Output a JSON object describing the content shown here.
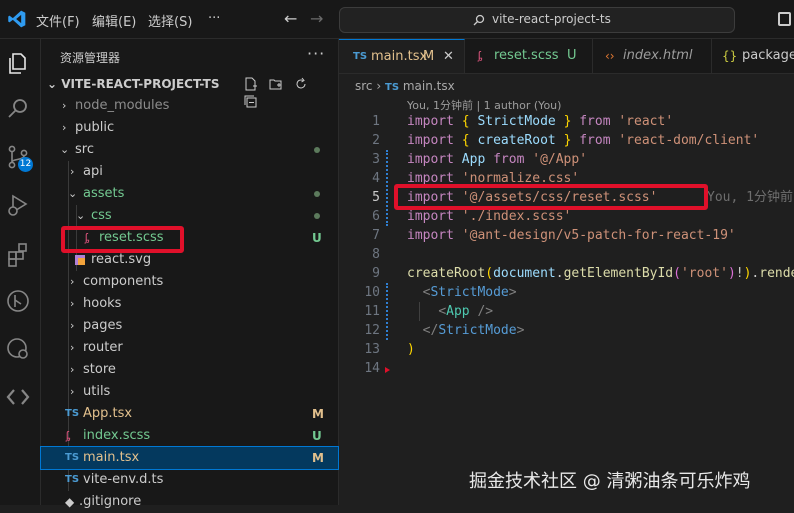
{
  "menubar": {
    "items": [
      "文件(F)",
      "编辑(E)",
      "选择(S)"
    ],
    "more": "···"
  },
  "search": {
    "text": "vite-react-project-ts"
  },
  "activity": {
    "scm_badge": "12"
  },
  "explorer": {
    "title": "资源管理器",
    "more": "···",
    "project": "VITE-REACT-PROJECT-TS",
    "rows": [
      {
        "label": "node_modules",
        "status": ""
      },
      {
        "label": "public",
        "status": ""
      },
      {
        "label": "src",
        "status": ""
      },
      {
        "label": "api",
        "status": ""
      },
      {
        "label": "assets",
        "status": ""
      },
      {
        "label": "css",
        "status": ""
      },
      {
        "label": "reset.scss",
        "status": "U"
      },
      {
        "label": "react.svg",
        "status": ""
      },
      {
        "label": "components",
        "status": ""
      },
      {
        "label": "hooks",
        "status": ""
      },
      {
        "label": "pages",
        "status": ""
      },
      {
        "label": "router",
        "status": ""
      },
      {
        "label": "store",
        "status": ""
      },
      {
        "label": "utils",
        "status": ""
      },
      {
        "label": "App.tsx",
        "status": "M"
      },
      {
        "label": "index.scss",
        "status": "U"
      },
      {
        "label": "main.tsx",
        "status": "M"
      },
      {
        "label": "vite-env.d.ts",
        "status": ""
      },
      {
        "label": ".gitignore",
        "status": ""
      }
    ],
    "ts_badge": "TS"
  },
  "tabs": [
    {
      "label": "main.tsx",
      "badge": "M"
    },
    {
      "label": "reset.scss",
      "badge": "U"
    },
    {
      "label": "index.html",
      "badge": ""
    },
    {
      "label": "package.",
      "badge": ""
    }
  ],
  "breadcrumb": {
    "folder": "src",
    "sep": "›",
    "file": "main.tsx"
  },
  "blame": "You, 1分钟前 | 1 author (You)",
  "inline_blame": "You, 1分钟前",
  "code": {
    "line_numbers": [
      "1",
      "2",
      "3",
      "4",
      "5",
      "6",
      "7",
      "8",
      "9",
      "10",
      "11",
      "12",
      "13",
      "14"
    ],
    "l1": {
      "kw1": "import",
      "b1": "{",
      "id": "StrictMode",
      "b2": "}",
      "kw2": "from",
      "str": "'react'"
    },
    "l2": {
      "kw1": "import",
      "b1": "{",
      "id": "createRoot",
      "b2": "}",
      "kw2": "from",
      "str": "'react-dom/client'"
    },
    "l3": {
      "kw1": "import",
      "id": "App",
      "kw2": "from",
      "str": "'@/App'"
    },
    "l4": {
      "kw1": "import",
      "str": "'normalize.css'"
    },
    "l5": {
      "kw1": "import",
      "str": "'@/assets/css/reset.scss'"
    },
    "l6": {
      "kw1": "import",
      "str": "'./index.scss'"
    },
    "l7": {
      "kw1": "import",
      "str": "'@ant-design/v5-patch-for-react-19'"
    },
    "l9": {
      "fn": "createRoot",
      "p1": "(",
      "obj": "document",
      "dot": ".",
      "fn2": "getElementById",
      "p2": "(",
      "str": "'root'",
      "p3": ")",
      "bang": "!",
      "p4": ")",
      "dot2": ".",
      "fn3": "render"
    },
    "l10": {
      "open": "<",
      "tag": "StrictMode",
      "close": ">"
    },
    "l11": {
      "open": "<",
      "tag": "App",
      "close": " />"
    },
    "l12": {
      "open": "</",
      "tag": "StrictMode",
      "close": ">"
    },
    "l13": {
      "p": ")"
    }
  },
  "watermark": "掘金技术社区 @ 清粥油条可乐炸鸡",
  "colors": {
    "accent": "#0078d4",
    "highlight_box": "#e0102a",
    "untracked": "#73c991",
    "modified": "#e2c08d"
  }
}
